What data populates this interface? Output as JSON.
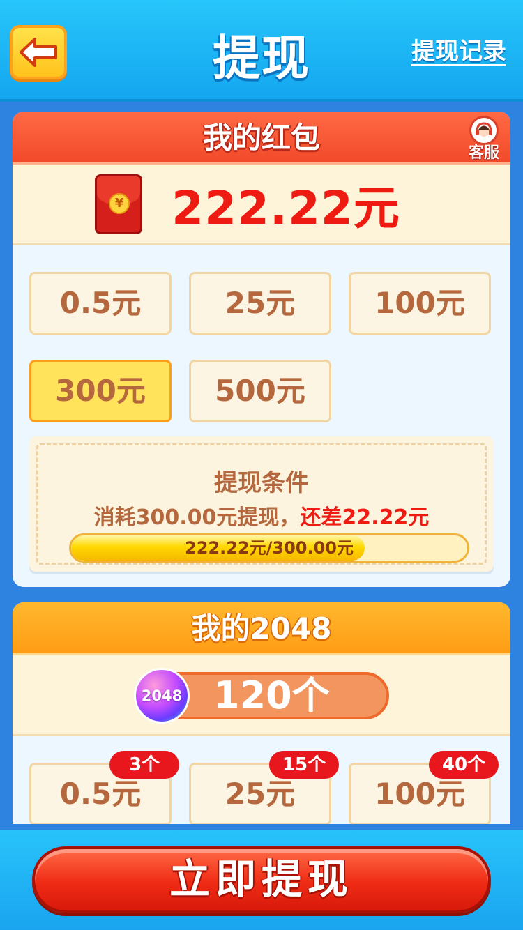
{
  "header": {
    "title": "提现",
    "records_link": "提现记录",
    "back_icon": "left-arrow-icon"
  },
  "red_packet": {
    "title": "我的红包",
    "service_label": "客服",
    "balance": "222.22元",
    "envelope_symbol": "¥",
    "options": [
      {
        "label": "0.5元",
        "selected": false
      },
      {
        "label": "25元",
        "selected": false
      },
      {
        "label": "100元",
        "selected": false
      },
      {
        "label": "300元",
        "selected": true
      },
      {
        "label": "500元",
        "selected": false
      }
    ],
    "conditions": {
      "title": "提现条件",
      "line_prefix": "消耗300.00元提现，",
      "line_diff": "还差22.22元",
      "progress_text": "222.22元/300.00元",
      "progress_fraction": 0.7407
    }
  },
  "tiles": {
    "title": "我的2048",
    "ball_label": "2048",
    "count": "120个",
    "options": [
      {
        "label": "0.5元",
        "tag": "3个"
      },
      {
        "label": "25元",
        "tag": "15个"
      },
      {
        "label": "100元",
        "tag": "40个"
      }
    ]
  },
  "footer": {
    "withdraw_button": "立即提现"
  },
  "colors": {
    "accent_red": "#ee1b12",
    "header_blue": "#1fb4f5",
    "selected_yellow": "#ffe35a"
  }
}
